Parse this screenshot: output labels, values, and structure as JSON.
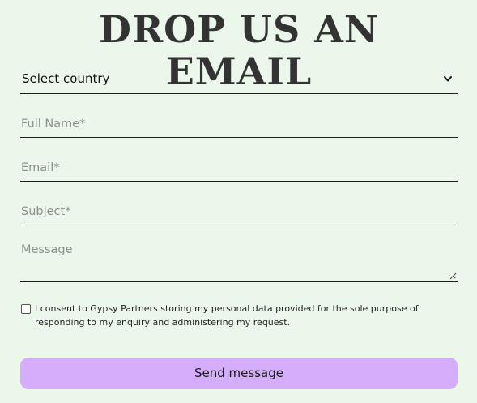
{
  "form": {
    "title": "DROP US AN EMAIL",
    "country_select": {
      "value": "Select country",
      "icon": "chevron-down-icon"
    },
    "fields": {
      "full_name": {
        "placeholder": "Full Name*"
      },
      "email": {
        "placeholder": "Email*"
      },
      "subject": {
        "placeholder": "Subject*"
      },
      "message": {
        "placeholder": "Message"
      }
    },
    "consent": {
      "checked": false,
      "text": "I consent to Gypsy Partners storing my personal data provided for the sole purpose of responding to my enquiry and administering my request."
    },
    "submit_label": "Send message"
  },
  "colors": {
    "background": "#EAF7EA",
    "title": "#333333",
    "button": "#D4AEFA",
    "placeholder": "#8d918d",
    "underline": "#1e1e1e"
  }
}
